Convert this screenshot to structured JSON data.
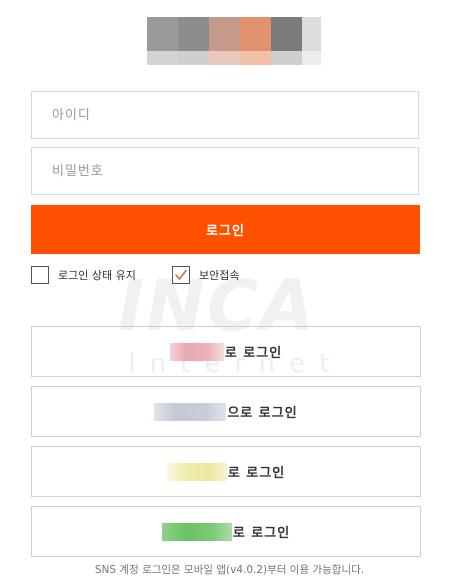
{
  "logo": {
    "name": "blurred-logo"
  },
  "login_form": {
    "id_placeholder": "아이디",
    "pw_placeholder": "비밀번호",
    "login_label": "로그인",
    "keep_login_label": "로그인 상태 유지",
    "keep_login_checked": false,
    "secure_label": "보안접속",
    "secure_checked": true
  },
  "watermark": {
    "main": "INCA",
    "sub": "Internet"
  },
  "sns_buttons": [
    {
      "suffix": "로 로그인"
    },
    {
      "suffix": "으로 로그인"
    },
    {
      "suffix": "로 로그인"
    },
    {
      "suffix": "로 로그인"
    }
  ],
  "footer_note": "SNS 계정 로그인은 모바일 앱(v4.0.2)부터 이용 가능합니다.",
  "colors": {
    "accent": "#ff5000",
    "checkmark": "#e06a1e"
  }
}
